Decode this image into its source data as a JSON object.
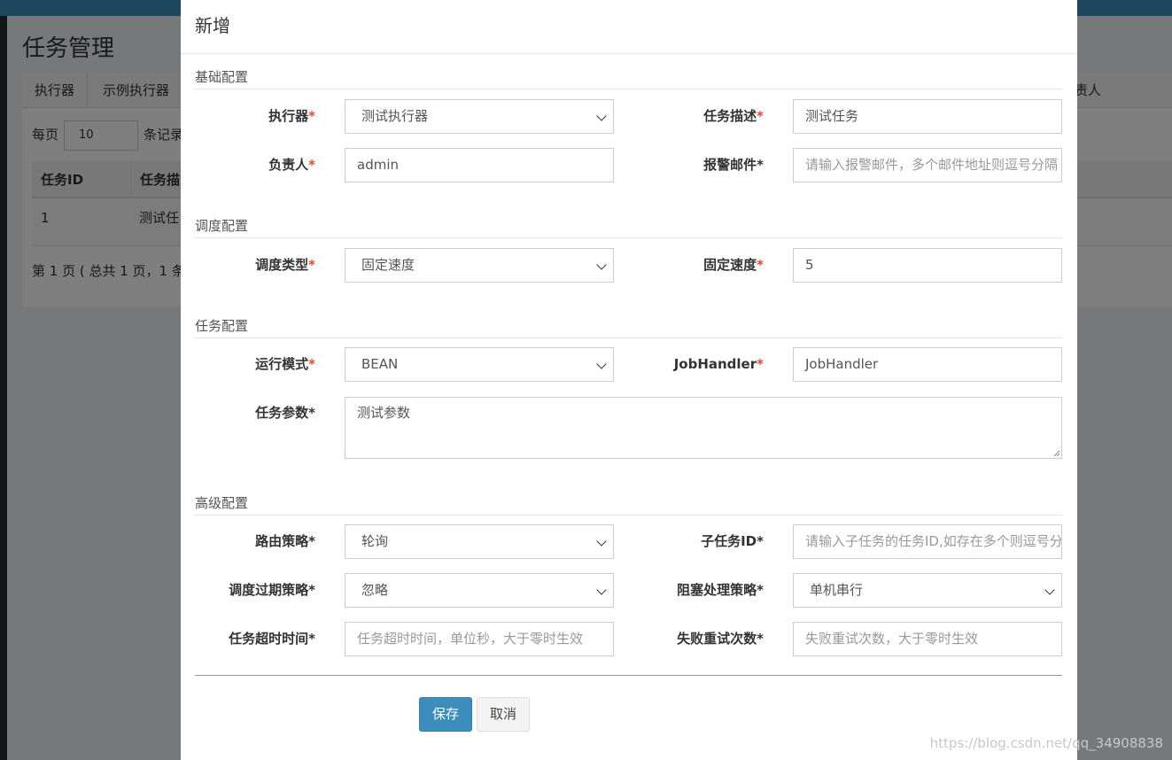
{
  "background": {
    "page_title": "任务管理",
    "tabs": [
      "执行器",
      "示例执行器"
    ],
    "tab_right_label": "责人",
    "per_page_label": "每页",
    "per_page_value": "10",
    "records_label": "条记录",
    "table_headers": [
      "任务ID",
      "任务描"
    ],
    "table_row": [
      "1",
      "测试任"
    ],
    "footer": "第 1 页 ( 总共 1 页，1 条"
  },
  "modal": {
    "title": "新增",
    "sections": {
      "basic": "基础配置",
      "schedule": "调度配置",
      "task": "任务配置",
      "advanced": "高级配置"
    },
    "fields": {
      "executor": {
        "label": "执行器",
        "value": "测试执行器"
      },
      "task_desc": {
        "label": "任务描述",
        "value": "测试任务"
      },
      "owner": {
        "label": "负责人",
        "value": "admin"
      },
      "alarm_email": {
        "label": "报警邮件",
        "placeholder": "请输入报警邮件，多个邮件地址则逗号分隔"
      },
      "schedule_type": {
        "label": "调度类型",
        "value": "固定速度"
      },
      "fix_rate": {
        "label": "固定速度",
        "value": "5"
      },
      "run_mode": {
        "label": "运行模式",
        "value": "BEAN"
      },
      "job_handler": {
        "label": "JobHandler",
        "value": "JobHandler"
      },
      "task_param": {
        "label": "任务参数",
        "value": "测试参数"
      },
      "route_strategy": {
        "label": "路由策略",
        "value": "轮询"
      },
      "child_job_id": {
        "label": "子任务ID",
        "placeholder": "请输入子任务的任务ID,如存在多个则逗号分隔"
      },
      "misfire_strategy": {
        "label": "调度过期策略",
        "value": "忽略"
      },
      "block_strategy": {
        "label": "阻塞处理策略",
        "value": "单机串行"
      },
      "timeout": {
        "label": "任务超时时间",
        "placeholder": "任务超时时间，单位秒，大于零时生效"
      },
      "fail_retry": {
        "label": "失败重试次数",
        "placeholder": "失败重试次数，大于零时生效"
      }
    },
    "required_mark": "*",
    "buttons": {
      "save": "保存",
      "cancel": "取消"
    }
  },
  "watermark": "https://blog.csdn.net/qq_34908838",
  "colors": {
    "primary": "#3c8dbc",
    "required": "#dd4b39",
    "topbar": "#3c8dbc"
  }
}
